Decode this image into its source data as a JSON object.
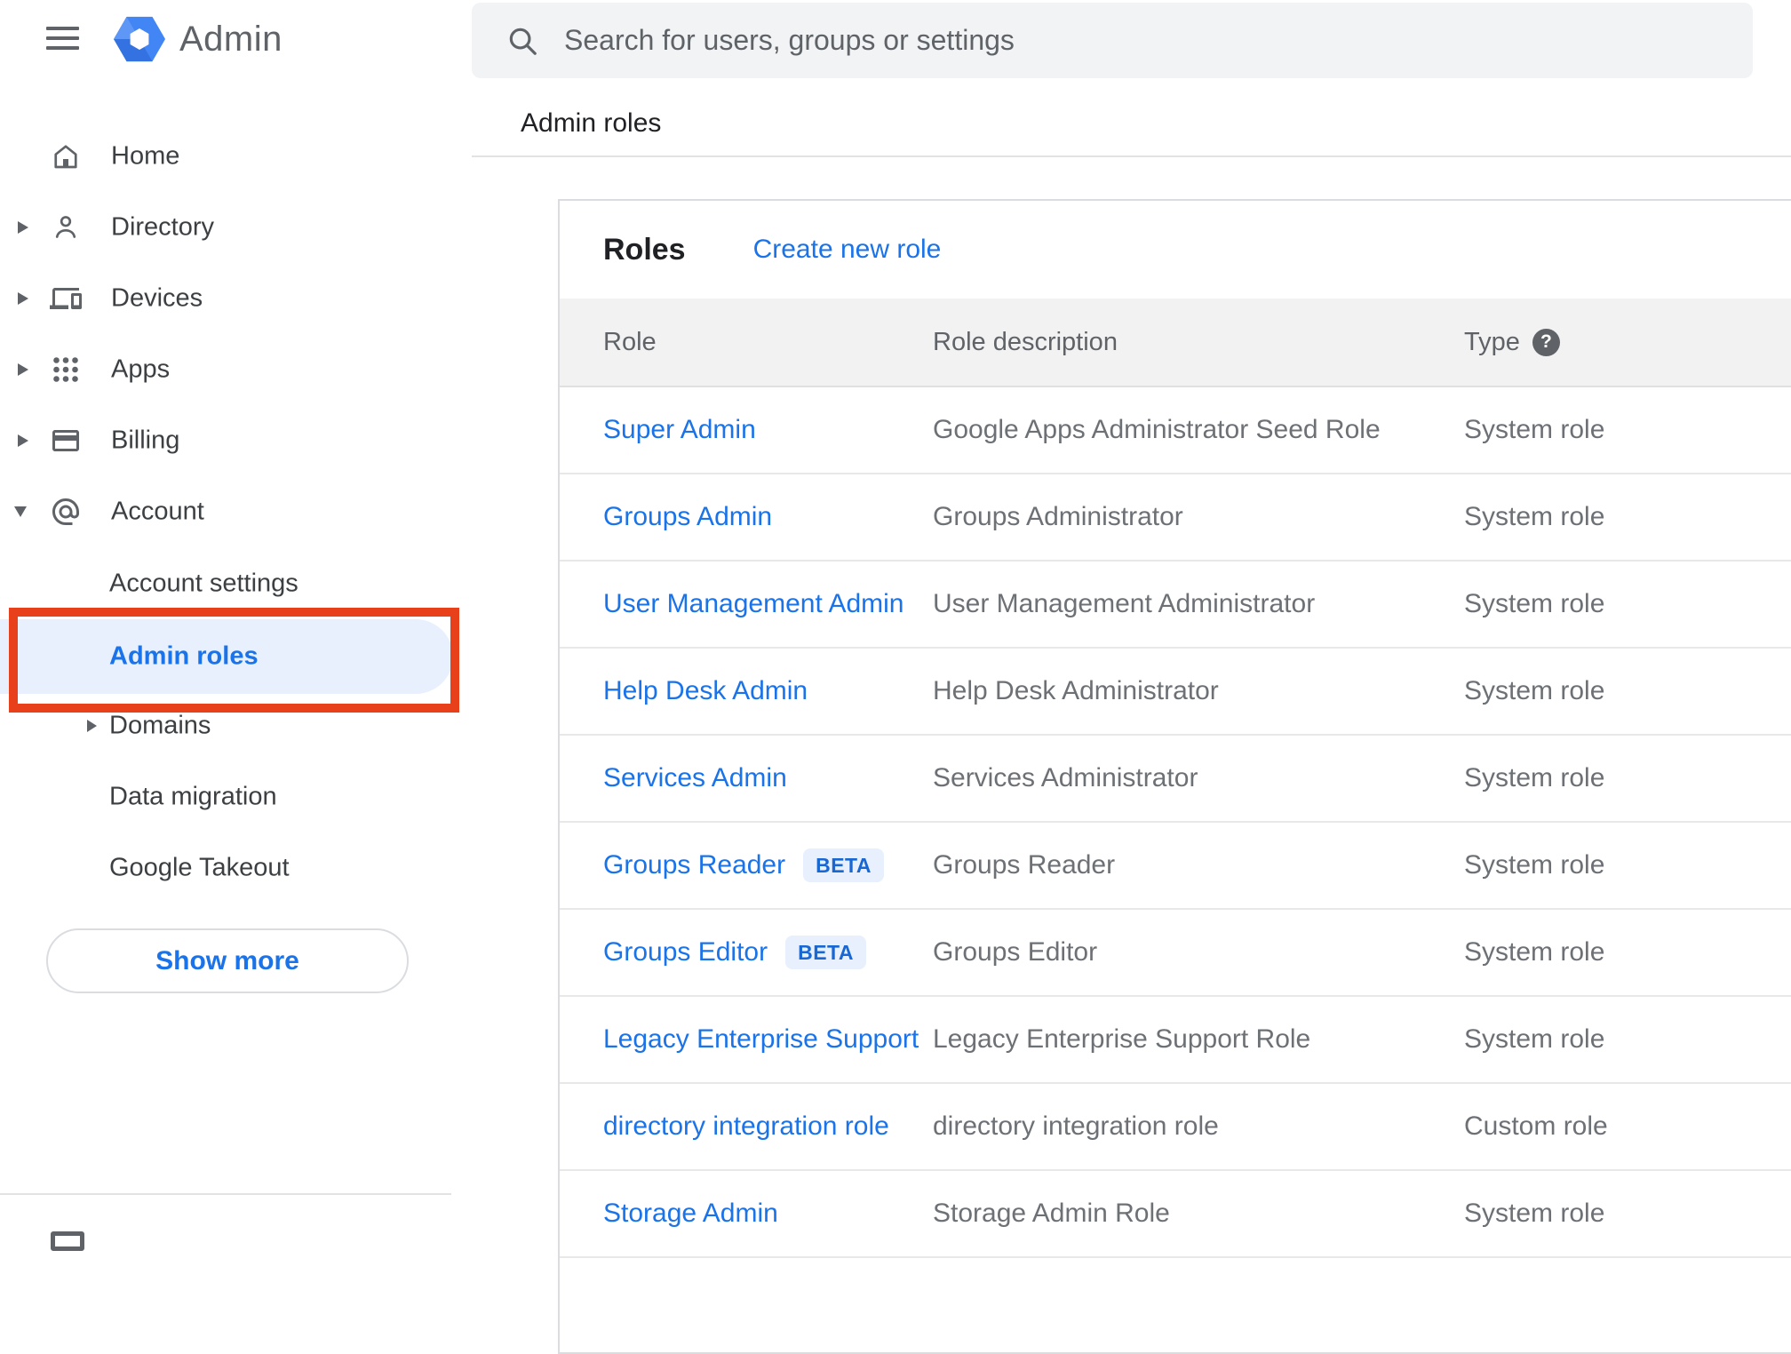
{
  "app": {
    "name": "Admin"
  },
  "search": {
    "placeholder": "Search for users, groups or settings"
  },
  "page": {
    "breadcrumb": "Admin roles"
  },
  "sidebar": {
    "items": [
      {
        "label": "Home"
      },
      {
        "label": "Directory"
      },
      {
        "label": "Devices"
      },
      {
        "label": "Apps"
      },
      {
        "label": "Billing"
      },
      {
        "label": "Account"
      }
    ],
    "account_children": [
      {
        "label": "Account settings"
      },
      {
        "label": "Admin roles",
        "active": true
      },
      {
        "label": "Domains"
      },
      {
        "label": "Data migration"
      },
      {
        "label": "Google Takeout"
      }
    ],
    "show_more": "Show more"
  },
  "roles_card": {
    "title": "Roles",
    "create_link": "Create new role",
    "columns": {
      "role": "Role",
      "description": "Role description",
      "type": "Type"
    },
    "beta_label": "BETA",
    "rows": [
      {
        "role": "Super Admin",
        "description": "Google Apps Administrator Seed Role",
        "type": "System role"
      },
      {
        "role": "Groups Admin",
        "description": "Groups Administrator",
        "type": "System role"
      },
      {
        "role": "User Management Admin",
        "description": "User Management Administrator",
        "type": "System role"
      },
      {
        "role": "Help Desk Admin",
        "description": "Help Desk Administrator",
        "type": "System role"
      },
      {
        "role": "Services Admin",
        "description": "Services Administrator",
        "type": "System role"
      },
      {
        "role": "Groups Reader",
        "beta": true,
        "description": "Groups Reader",
        "type": "System role"
      },
      {
        "role": "Groups Editor",
        "beta": true,
        "description": "Groups Editor",
        "type": "System role"
      },
      {
        "role": "Legacy Enterprise Support",
        "description": "Legacy Enterprise Support Role",
        "type": "System role"
      },
      {
        "role": "directory integration role",
        "description": "directory integration role",
        "type": "Custom role"
      },
      {
        "role": "Storage Admin",
        "description": "Storage Admin Role",
        "type": "System role"
      }
    ]
  },
  "colors": {
    "primary_blue": "#1a73e8",
    "logo_blue": "#4285f4",
    "annotation_red": "#e8401a",
    "active_item_bg": "#e8f0fe",
    "beta_badge_bg": "#e8f0fe",
    "beta_badge_text": "#1967d2",
    "table_header_bg": "#f2f2f2",
    "icon_gray": "#5f6368"
  }
}
